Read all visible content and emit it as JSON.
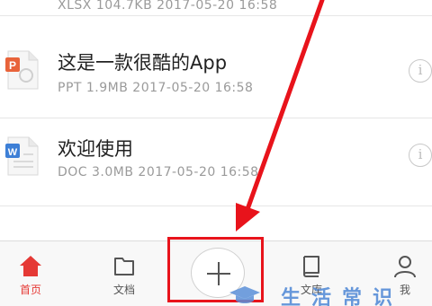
{
  "files": [
    {
      "name": "",
      "meta": "XLSX  104.7KB   2017-05-20 16:58",
      "type": "xlsx",
      "icon": "spreadsheet-file-icon"
    },
    {
      "name": "这是一款很酷的App",
      "meta": "PPT  1.9MB   2017-05-20 16:58",
      "type": "ppt",
      "icon": "ppt-file-icon",
      "icon_letter": "P",
      "icon_color": "#e8633a"
    },
    {
      "name": "欢迎使用",
      "meta": "DOC  3.0MB   2017-05-20 16:58",
      "type": "doc",
      "icon": "word-file-icon",
      "icon_letter": "W",
      "icon_color": "#3d7fd6"
    }
  ],
  "info_glyph": "i",
  "tabbar": {
    "home": {
      "label": "首页",
      "icon": "home-icon"
    },
    "docs": {
      "label": "文档",
      "icon": "folder-icon"
    },
    "add": {
      "icon": "plus-icon"
    },
    "library": {
      "label": "文库",
      "icon": "book-icon"
    },
    "me": {
      "label": "我",
      "icon": "user-icon"
    }
  },
  "annotation": {
    "color": "#e8131b"
  },
  "watermark": {
    "text": "生活常识"
  },
  "colors": {
    "active_tab": "#e53935",
    "highlight": "#e8131b",
    "watermark": "#5a8fd8"
  }
}
